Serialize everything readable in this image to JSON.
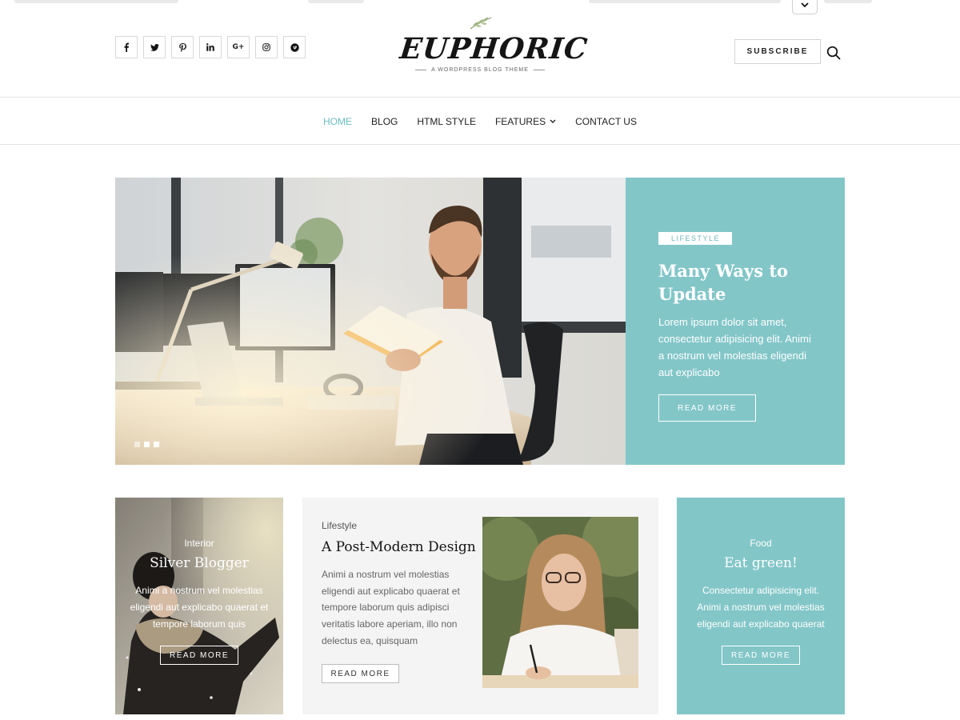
{
  "header": {
    "social": [
      {
        "icon": "facebook-icon",
        "glyph": "f"
      },
      {
        "icon": "twitter-icon",
        "glyph": "🐦"
      },
      {
        "icon": "pinterest-icon",
        "glyph": "P"
      },
      {
        "icon": "linkedin-icon",
        "glyph": "in"
      },
      {
        "icon": "google-plus-icon",
        "glyph": "G+"
      },
      {
        "icon": "instagram-icon",
        "glyph": "◎"
      },
      {
        "icon": "vimeo-icon",
        "glyph": "▼"
      }
    ],
    "logo_text": "EUPHORIC",
    "tagline": "A WORDPRESS BLOG THEME",
    "subscribe_label": "SUBSCRIBE"
  },
  "nav": {
    "items": [
      {
        "label": "HOME",
        "active": true
      },
      {
        "label": "BLOG"
      },
      {
        "label": "HTML STYLE"
      },
      {
        "label": "FEATURES",
        "dropdown": true
      },
      {
        "label": "CONTACT US"
      }
    ]
  },
  "hero": {
    "category": "LIFESTYLE",
    "title": "Many Ways to Update",
    "excerpt": "Lorem ipsum dolor sit amet, consectetur adipisicing elit. Animi a nostrum vel molestias eligendi aut explicabo",
    "read_more": "READ MORE"
  },
  "cards": {
    "interior": {
      "category": "Interior",
      "title": "Silver Blogger",
      "excerpt": "Animi a nostrum vel molestias eligendi aut explicabo quaerat et tempore laborum quis",
      "read_more": "READ MORE"
    },
    "post": {
      "category": "Lifestyle",
      "title": "A Post-Modern Design",
      "excerpt": "Animi a nostrum vel molestias eligendi aut explicabo quaerat et tempore laborum quis adipisci veritatis labore aperiam, illo non delectus ea, quisquam",
      "read_more": "READ MORE"
    },
    "food": {
      "category": "Food",
      "title": "Eat green!",
      "excerpt": "Consectetur adipisicing elit. Animi a nostrum vel molestias eligendi aut explicabo quaerat",
      "read_more": "READ MORE"
    }
  },
  "colors": {
    "accent": "#83c6c8",
    "nav_active": "#6bbcc2",
    "card_bg": "#f4f4f4"
  }
}
